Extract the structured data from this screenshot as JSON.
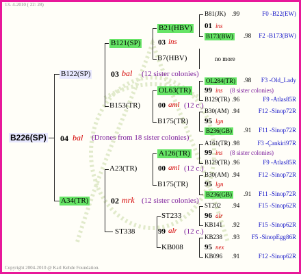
{
  "header": {
    "date": "13- 4-2010 ( 22: 28)"
  },
  "footer": {
    "copyright": "Copyright 2004-2010 @ Karl Kehde Foundation."
  },
  "root": {
    "id": "B226(SP)",
    "year": "04",
    "race": "bal",
    "note": "(Drones from 18 sister colonies)"
  },
  "gen2": [
    {
      "id": "B122(SP)",
      "year": "03",
      "race": "bal",
      "note": "(12 sister colonies)"
    },
    {
      "id": "A34(TR)",
      "year": "02",
      "race": "mrk",
      "note": "(12 sister colonies)"
    }
  ],
  "gen3": [
    {
      "id": "B121(SP)",
      "year": "03",
      "race": "ins"
    },
    {
      "id": "B153(TR)",
      "year": "00",
      "race": "aml",
      "note": "(12 c.)"
    },
    {
      "id": "A23(TR)",
      "year": "00",
      "race": "aml",
      "note": "(12 c.)"
    },
    {
      "id": "ST338",
      "year": "99",
      "race": "alr",
      "note": "(12 c.)"
    }
  ],
  "gen4": [
    {
      "id": "B21(HBV)",
      "year": "01",
      "race": "ins"
    },
    {
      "id": "B7(HBV)",
      "extra": "no more"
    },
    {
      "id": "OL63(TR)",
      "year": "99",
      "race": "ins",
      "note": "(8 sister colonies)"
    },
    {
      "id": "B175(TR)",
      "year": "95",
      "race": "lgn"
    },
    {
      "id": "A126(TR)",
      "year": "99",
      "race": "ins",
      "note": "(8 sister colonies)"
    },
    {
      "id": "B175(TR)",
      "year": "95",
      "race": "lgn"
    },
    {
      "id": "ST233",
      "year": "96",
      "race": "alr"
    },
    {
      "id": "KB008",
      "year": "95",
      "race": "nex"
    }
  ],
  "gen5": [
    {
      "id": "B81(JK)",
      "val": ".99",
      "ref": "F0 -B22(EW)"
    },
    {
      "id": "B173(BW)",
      "val": ".98",
      "ref": "F2 -B173(BW)"
    },
    {
      "id": "OL284(TR)",
      "val": ".98",
      "ref": "F3 -Old_Lady"
    },
    {
      "id": "B129(TR)",
      "val": ".96",
      "ref": "F9 -Atlas85R"
    },
    {
      "id": "B30(AM)",
      "val": ".94",
      "ref": "F12 -Sinop72R"
    },
    {
      "id": "B236(GB)",
      "val": ".91",
      "ref": "F11 -Sinop72R"
    },
    {
      "id": "A161(TR)",
      "val": ".98",
      "ref": "F3 -Çankiri97R"
    },
    {
      "id": "B129(TR)",
      "val": ".96",
      "ref": "F9 -Atlas85R"
    },
    {
      "id": "B30(AM)",
      "val": ".94",
      "ref": "F12 -Sinop72R"
    },
    {
      "id": "B236(GB)",
      "val": ".91",
      "ref": "F11 -Sinop72R"
    },
    {
      "id": "ST202",
      "val": ".94",
      "ref": "F15 -Sinop62R"
    },
    {
      "id": "KB141",
      "val": ".92",
      "ref": "F15 -Sinop62R"
    },
    {
      "id": "KB238",
      "val": ".93",
      "ref": "F5 -SinopEgg86R"
    },
    {
      "id": "KB096",
      "val": ".91",
      "ref": "F12 -Sinop62R"
    }
  ]
}
